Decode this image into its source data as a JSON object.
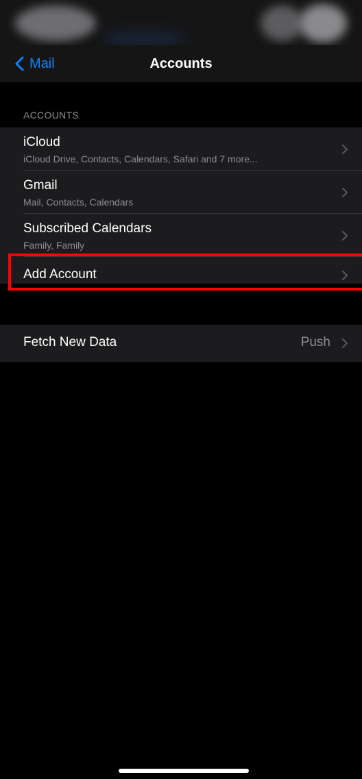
{
  "nav": {
    "back_label": "Mail",
    "title": "Accounts"
  },
  "accounts_section": {
    "header": "ACCOUNTS",
    "items": [
      {
        "title": "iCloud",
        "subtitle": "iCloud Drive, Contacts, Calendars, Safari and 7 more..."
      },
      {
        "title": "Gmail",
        "subtitle": "Mail, Contacts, Calendars"
      },
      {
        "title": "Subscribed Calendars",
        "subtitle": "Family, Family"
      },
      {
        "title": "Add Account"
      }
    ]
  },
  "fetch": {
    "title": "Fetch New Data",
    "value": "Push"
  },
  "colors": {
    "accent": "#0a84ff",
    "highlight": "#ff0000",
    "cell_background": "#1c1c1e",
    "secondary_text": "#8d8d92"
  },
  "icons": {
    "back": "chevron-left-icon",
    "disclosure": "chevron-right-icon"
  }
}
